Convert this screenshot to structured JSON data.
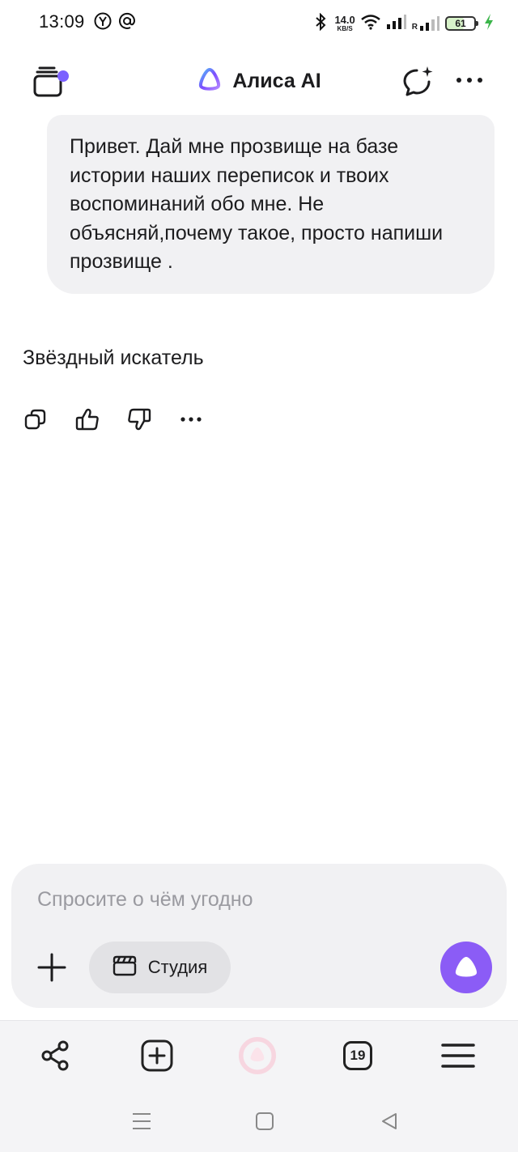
{
  "status_bar": {
    "time": "13:09",
    "net_speed_value": "14.0",
    "net_speed_unit": "KB/S",
    "roaming_label": "R",
    "battery": "61",
    "icons": [
      "yandex-browser-icon",
      "at-icon",
      "bluetooth-icon",
      "wifi-icon",
      "signal-icon",
      "charging-icon"
    ]
  },
  "header": {
    "title": "Алиса AI",
    "icons": [
      "chat-history-icon",
      "alice-logo-icon",
      "new-chat-icon",
      "more-icon"
    ]
  },
  "chat": {
    "user_message": "Привет. Дай мне прозвище на базе истории наших переписок и твоих воспоминаний обо мне. Не объясняй,почему такое, просто напиши прозвище .",
    "assistant_message": "Звёздный искатель",
    "action_icons": [
      "copy-icon",
      "thumbs-up-icon",
      "thumbs-down-icon",
      "more-icon"
    ]
  },
  "composer": {
    "placeholder": "Спросите о чём угодно",
    "value": "",
    "studio_label": "Студия"
  },
  "bottom_nav": {
    "tabs_count": "19",
    "icons": [
      "share-icon",
      "new-tab-icon",
      "alice-icon",
      "tabs-icon",
      "menu-icon"
    ]
  },
  "colors": {
    "accent": "#8b5cf6",
    "bubble": "#f1f1f3",
    "unread_dot": "#7b61ff"
  }
}
